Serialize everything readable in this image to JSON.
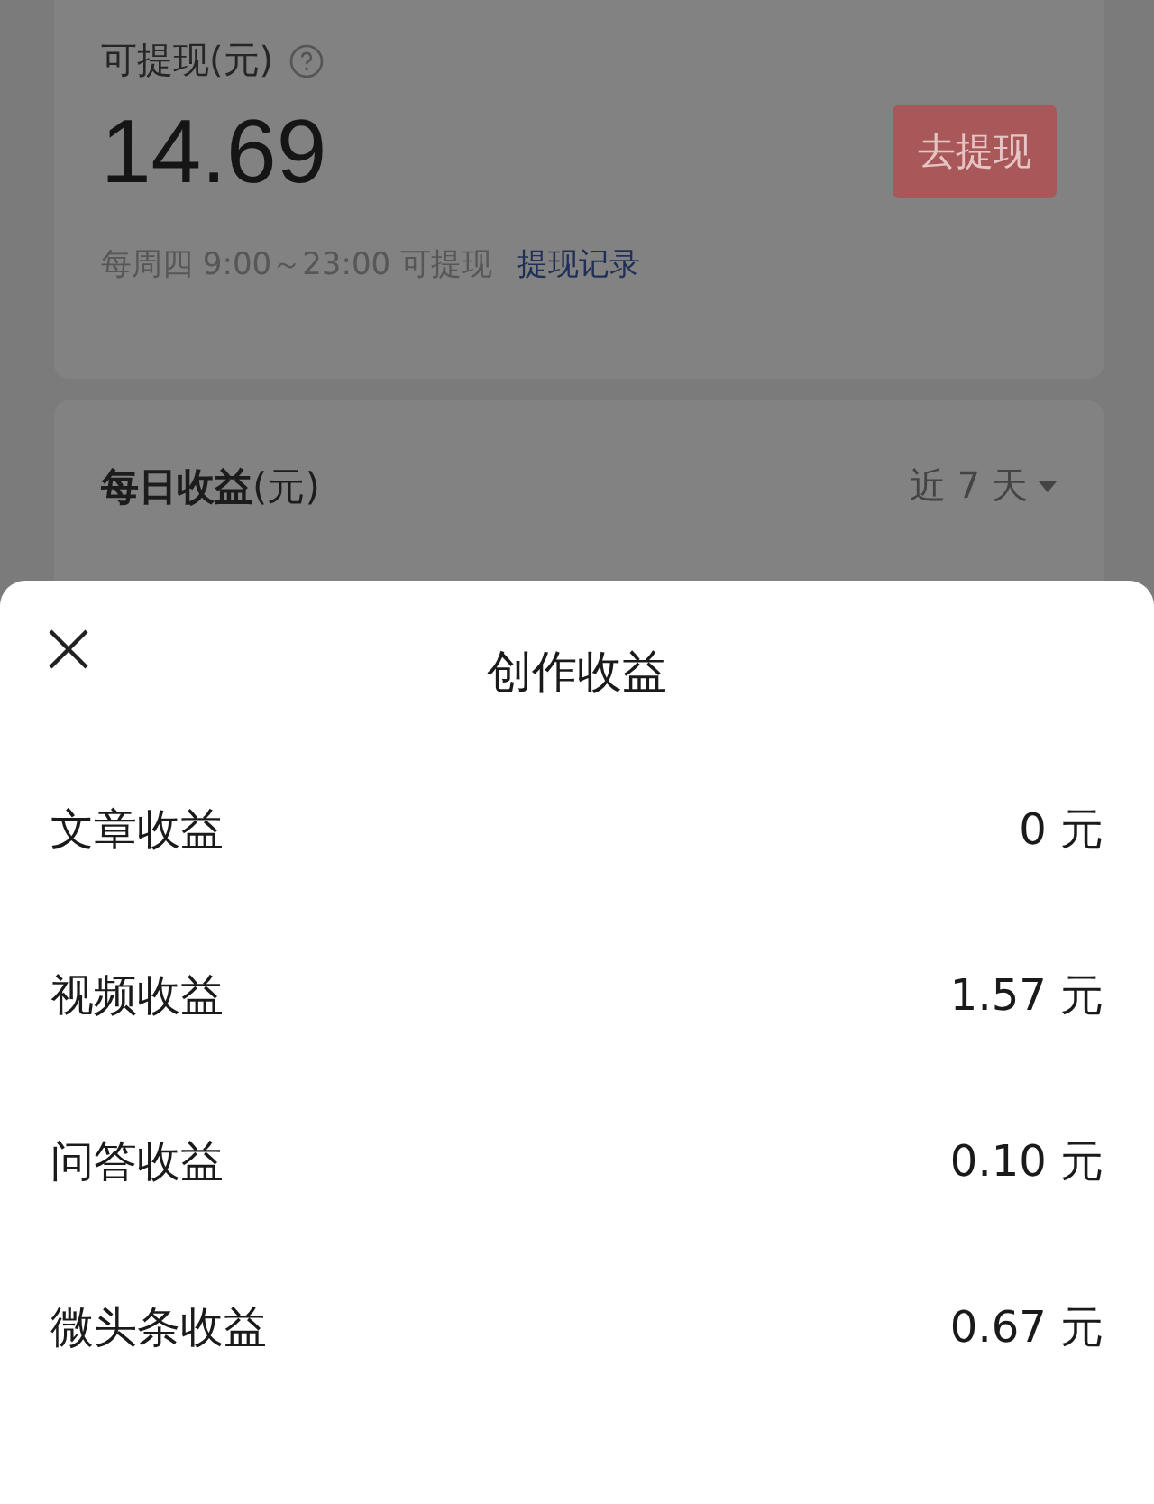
{
  "balance_card": {
    "label": "可提现(元)",
    "amount": "14.69",
    "withdraw_button": "去提现",
    "schedule": "每周四 9:00～23:00 可提现",
    "history_link": "提现记录"
  },
  "daily_card": {
    "title": "**每日收益**(元)",
    "range": "近 7 天"
  },
  "sheet": {
    "title": "创作收益",
    "rows": [
      {
        "label": "文章收益",
        "value": "0 元"
      },
      {
        "label": "视频收益",
        "value": "1.57 元"
      },
      {
        "label": "问答收益",
        "value": "0.10 元"
      },
      {
        "label": "微头条收益",
        "value": "0.67 元"
      }
    ]
  }
}
